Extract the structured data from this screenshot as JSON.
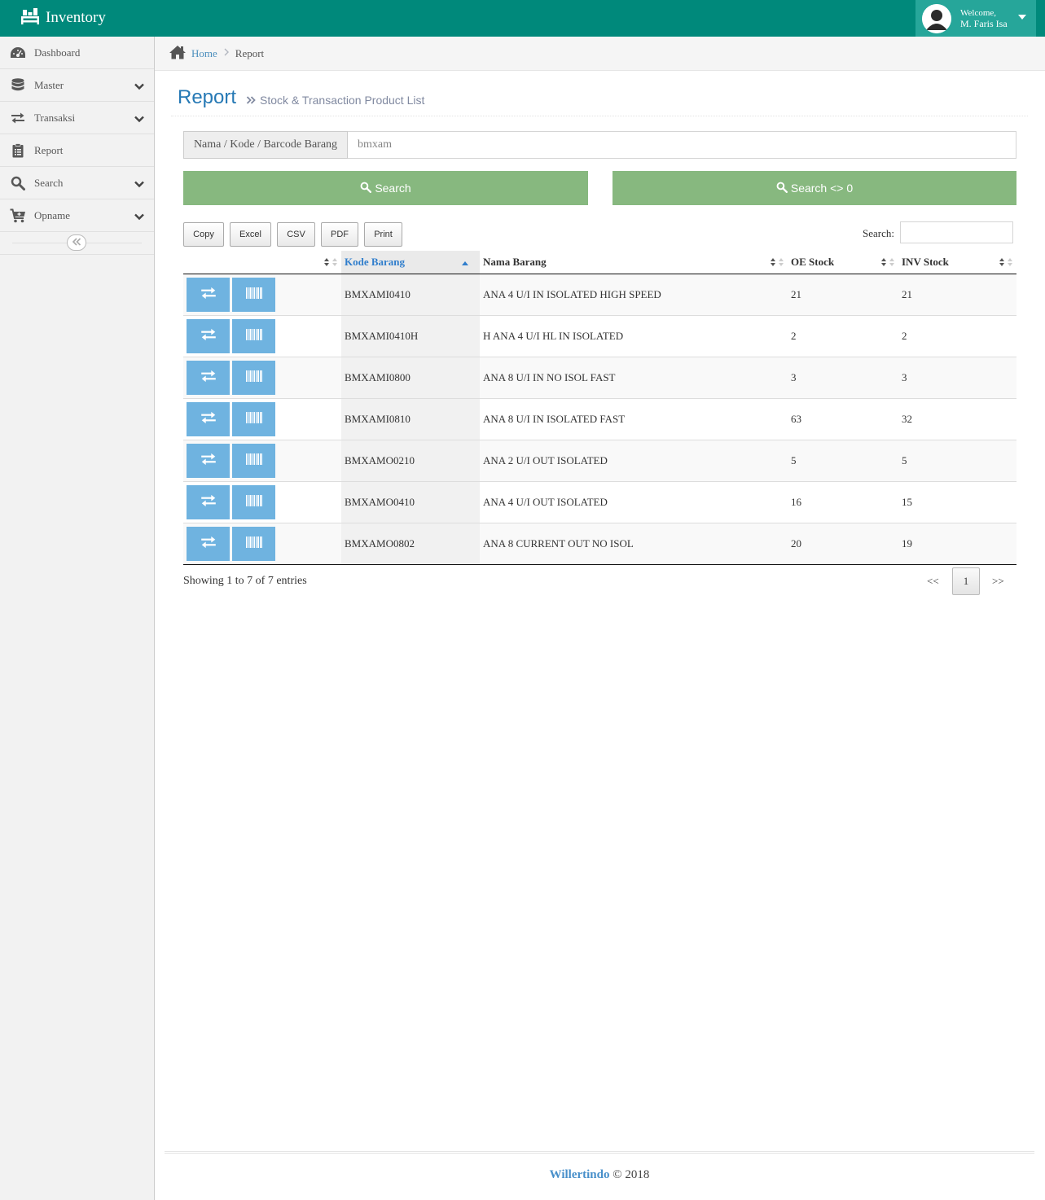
{
  "app": {
    "title": "Inventory"
  },
  "user": {
    "welcome": "Welcome,",
    "name": "M. Faris Isa"
  },
  "sidebar": {
    "items": [
      {
        "label": "Dashboard"
      },
      {
        "label": "Master"
      },
      {
        "label": "Transaksi"
      },
      {
        "label": "Report"
      },
      {
        "label": "Search"
      },
      {
        "label": "Opname"
      }
    ]
  },
  "breadcrumb": {
    "home": "Home",
    "current": "Report"
  },
  "page": {
    "title": "Report",
    "subtitle": "Stock & Transaction Product List"
  },
  "search": {
    "addon_label": "Nama / Kode / Barcode Barang",
    "value": "bmxam",
    "button": "Search",
    "button_nonzero": "Search <> 0"
  },
  "exports": {
    "copy": "Copy",
    "excel": "Excel",
    "csv": "CSV",
    "pdf": "PDF",
    "print": "Print"
  },
  "table_search_label": "Search:",
  "table": {
    "headers": {
      "kode": "Kode Barang",
      "nama": "Nama Barang",
      "oe": "OE Stock",
      "inv": "INV Stock"
    },
    "rows": [
      {
        "kode": "BMXAMI0410",
        "nama": "ANA 4 U/I IN ISOLATED HIGH SPEED",
        "oe": "21",
        "inv": "21"
      },
      {
        "kode": "BMXAMI0410H",
        "nama": "H ANA 4 U/I HL IN ISOLATED",
        "oe": "2",
        "inv": "2"
      },
      {
        "kode": "BMXAMI0800",
        "nama": "ANA 8 U/I IN NO ISOL FAST",
        "oe": "3",
        "inv": "3"
      },
      {
        "kode": "BMXAMI0810",
        "nama": "ANA 8 U/I IN ISOLATED FAST",
        "oe": "63",
        "inv": "32"
      },
      {
        "kode": "BMXAMO0210",
        "nama": "ANA 2 U/I OUT ISOLATED",
        "oe": "5",
        "inv": "5"
      },
      {
        "kode": "BMXAMO0410",
        "nama": "ANA 4 U/I OUT ISOLATED",
        "oe": "16",
        "inv": "15"
      },
      {
        "kode": "BMXAMO0802",
        "nama": "ANA 8 CURRENT OUT NO ISOL",
        "oe": "20",
        "inv": "19"
      }
    ]
  },
  "pagination": {
    "info": "Showing 1 to 7 of 7 entries",
    "prev": "<<",
    "page": "1",
    "next": ">>"
  },
  "footer": {
    "brand": "Willertindo",
    "copyright": "© 2018"
  }
}
